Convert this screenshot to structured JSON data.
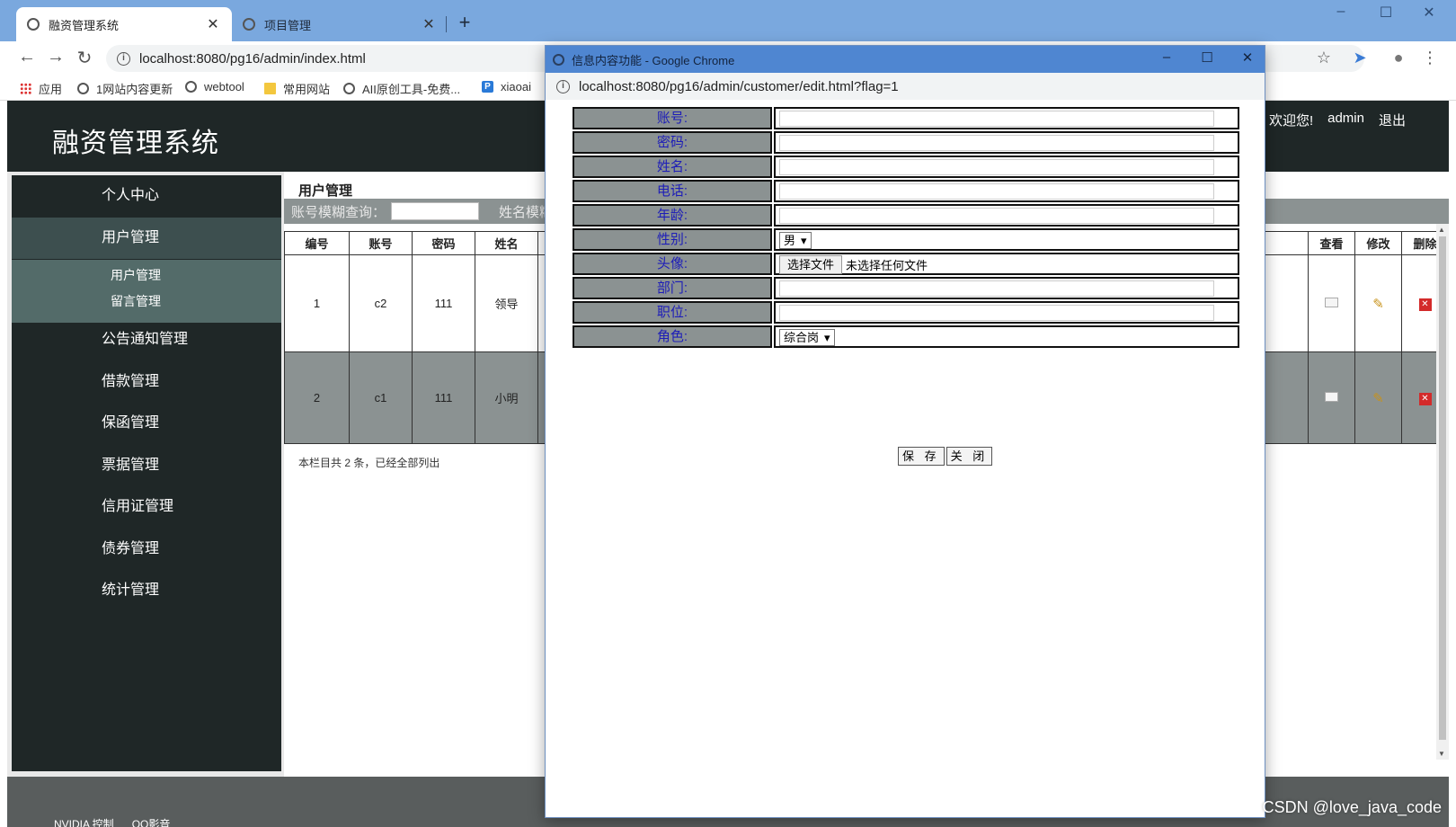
{
  "browser": {
    "tabs": [
      {
        "title": "融资管理系统"
      },
      {
        "title": "项目管理"
      }
    ],
    "url": "localhost:8080/pg16/admin/index.html",
    "bookmarks": [
      "应用",
      "1网站内容更新",
      "webtool",
      "常用网站",
      "AII原创工具-免费...",
      "xiaoai"
    ]
  },
  "app": {
    "title": "融资管理系统",
    "user": {
      "welcome": "欢迎您!",
      "name": "admin",
      "logout": "退出"
    },
    "menu": [
      {
        "label": "个人中心"
      },
      {
        "label": "用户管理"
      },
      {
        "label": "公告通知管理"
      },
      {
        "label": "借款管理"
      },
      {
        "label": "保函管理"
      },
      {
        "label": "票据管理"
      },
      {
        "label": "信用证管理"
      },
      {
        "label": "债券管理"
      },
      {
        "label": "统计管理"
      }
    ],
    "submenu": [
      "用户管理",
      "留言管理"
    ],
    "content_title": "用户管理",
    "search": {
      "label1": "账号模糊查询：",
      "label2": "姓名模糊"
    },
    "table": {
      "headers": [
        "编号",
        "账号",
        "密码",
        "姓名"
      ],
      "action_headers": [
        "查看",
        "修改",
        "删除"
      ],
      "rows": [
        {
          "id": "1",
          "account": "c2",
          "password": "111",
          "name": "领导"
        },
        {
          "id": "2",
          "account": "c1",
          "password": "111",
          "name": "小明"
        }
      ],
      "footer": "本栏目共 2 条，已经全部列出"
    }
  },
  "popup": {
    "title": "信息内容功能 - Google Chrome",
    "url": "localhost:8080/pg16/admin/customer/edit.html?flag=1",
    "fields": [
      {
        "label": "账号:",
        "type": "text"
      },
      {
        "label": "密码:",
        "type": "text"
      },
      {
        "label": "姓名:",
        "type": "text"
      },
      {
        "label": "电话:",
        "type": "text"
      },
      {
        "label": "年龄:",
        "type": "text"
      },
      {
        "label": "性别:",
        "type": "select",
        "value": "男"
      },
      {
        "label": "头像:",
        "type": "file",
        "button": "选择文件",
        "status": "未选择任何文件"
      },
      {
        "label": "部门:",
        "type": "text"
      },
      {
        "label": "职位:",
        "type": "text"
      },
      {
        "label": "角色:",
        "type": "select",
        "value": "综合岗"
      }
    ],
    "buttons": {
      "save": "保 存",
      "close": "关 闭"
    }
  },
  "taskbar": [
    "NVIDIA 控制",
    "QQ影音"
  ],
  "watermark": "CSDN @love_java_code"
}
